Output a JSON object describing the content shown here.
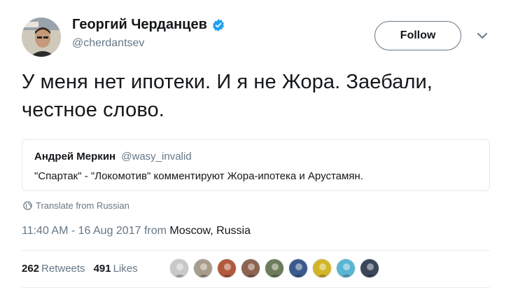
{
  "author": {
    "name": "Георгий Черданцев",
    "handle": "@cherdantsev",
    "verified": true,
    "avatar_icon": "profile-photo"
  },
  "follow_label": "Follow",
  "tweet_text": "У меня нет ипотеки. И я не Жора. Заебали, честное слово.",
  "quoted_tweet": {
    "name": "Андрей Меркин",
    "handle": "@wasy_invalid",
    "text": "\"Спартак\" - \"Локомотив\" комментируют Жора-ипотека и Арустамян."
  },
  "translate_label": "Translate from Russian",
  "timestamp": {
    "time": "11:40 AM - 16 Aug 2017 from ",
    "location": "Moscow, Russia"
  },
  "stats": {
    "retweets_count": "262",
    "retweets_label": "Retweets",
    "likes_count": "491",
    "likes_label": "Likes"
  },
  "likers": [
    {
      "icon": "liker-avatar-1",
      "color": "#c8c8c8"
    },
    {
      "icon": "liker-avatar-2",
      "color": "#a89c8c"
    },
    {
      "icon": "liker-avatar-3",
      "color": "#b05a3c"
    },
    {
      "icon": "liker-avatar-4",
      "color": "#8c6450"
    },
    {
      "icon": "liker-avatar-5",
      "color": "#6e7b5a"
    },
    {
      "icon": "liker-avatar-6",
      "color": "#3c5a8c"
    },
    {
      "icon": "liker-avatar-7",
      "color": "#d2b428"
    },
    {
      "icon": "liker-avatar-8",
      "color": "#5ab4d2"
    },
    {
      "icon": "liker-avatar-9",
      "color": "#3c465a"
    }
  ],
  "colors": {
    "accent": "#1da1f2",
    "text": "#14171a",
    "secondary": "#657786",
    "border": "#e1e8ed"
  }
}
